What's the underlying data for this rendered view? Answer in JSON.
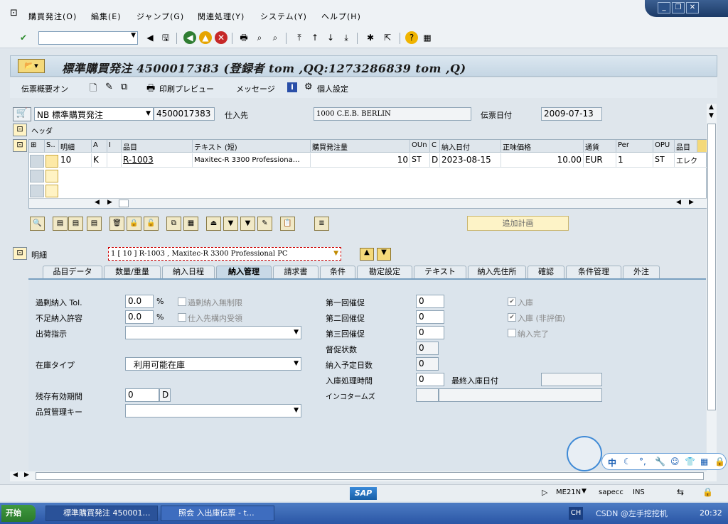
{
  "menu": [
    "購買発注(O)",
    "編集(E)",
    "ジャンプ(G)",
    "関連処理(Y)",
    "システム(Y)",
    "ヘルプ(H)"
  ],
  "title": "標準購買発注 4500017383 (登録者 tom ,QQ:1273286839 tom ,Q)",
  "appbar": {
    "summary": "伝票概要オン",
    "print": "印刷プレビュー",
    "messages": "メッセージ",
    "personal": "個人設定"
  },
  "header": {
    "doctype": "NB 標準購買発注",
    "po_number": "4500017383",
    "vendor_label": "仕入先",
    "vendor": "1000 C.E.B. BERLIN",
    "date_label": "伝票日付",
    "date": "2009-07-13",
    "header_label": "ヘッダ"
  },
  "items": {
    "columns": [
      "S..",
      "明細",
      "A",
      "I",
      "品目",
      "テキスト (短)",
      "購買発注量",
      "OUn",
      "C",
      "納入日付",
      "正味価格",
      "通貨",
      "Per",
      "OPU",
      "品目"
    ],
    "rows": [
      {
        "item": "10",
        "a": "K",
        "i": "",
        "material": "R-1003",
        "text": "Maxitec-R 3300 Professiona…",
        "qty": "10",
        "oun": "ST",
        "c": "D",
        "delivery": "2023-08-15",
        "price": "10.00",
        "currency": "EUR",
        "per": "1",
        "opu": "ST",
        "group": "エレク"
      }
    ]
  },
  "add_plan": "追加計画",
  "detail": {
    "label": "明細",
    "selection": "1 [ 10 ] R-1003 , Maxitec-R 3300 Professional PC"
  },
  "tabs": [
    "品目データ",
    "数量/重量",
    "納入日程",
    "納入管理",
    "請求書",
    "条件",
    "勘定設定",
    "テキスト",
    "納入先住所",
    "確認",
    "条件管理",
    "外注"
  ],
  "delivery": {
    "over_tol_label": "過剰納入 Tol.",
    "over_tol": "0.0",
    "under_tol_label": "不足納入許容",
    "under_tol": "0.0",
    "percent": "%",
    "unlimited": "過剰納入無制限",
    "gr_in_vendor": "仕入先構内受領",
    "shipping_label": "出荷指示",
    "stock_type_label": "在庫タイプ",
    "stock_type": "利用可能在庫",
    "shelf_label": "残存有効期間",
    "shelf": "0",
    "shelf_unit": "D",
    "qm_label": "品質管理キー",
    "rem1_label": "第一回催促",
    "rem1": "0",
    "rem2_label": "第二回催促",
    "rem2": "0",
    "rem3_label": "第三回催促",
    "rem3": "0",
    "urge_label": "督促状数",
    "urge": "0",
    "pdt_label": "納入予定日数",
    "pdt": "0",
    "grpt_label": "入庫処理時間",
    "grpt": "0",
    "last_gr_label": "最終入庫日付",
    "inco_label": "インコタームズ",
    "gr_label": "入庫",
    "gr_nonval_label": "入庫 (非評価)",
    "delivered_label": "納入完了"
  },
  "status": {
    "tcode": "ME21N",
    "server": "sapecc",
    "mode": "INS"
  },
  "taskbar": {
    "start": "开始",
    "task1": "標準購買発注 450001…",
    "task2": "照会 入出庫伝票 - t…",
    "lang": "CH",
    "watermark": "CSDN @左手挖挖机",
    "time": "20:32"
  },
  "ime": {
    "label": "中"
  }
}
